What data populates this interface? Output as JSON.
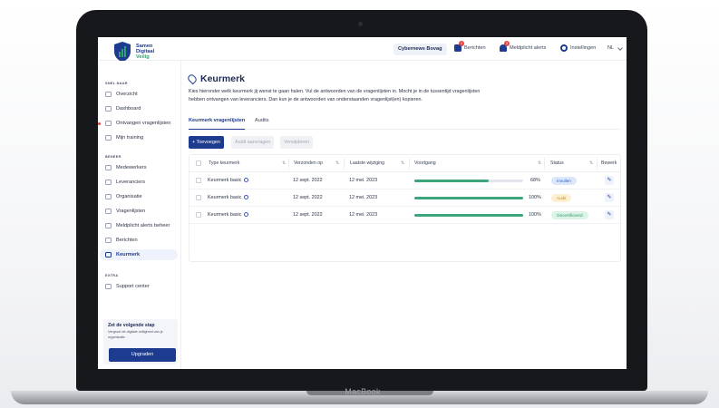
{
  "device": {
    "brand": "MacBook"
  },
  "app": {
    "logo": {
      "line1": "Samen",
      "line2": "Digitaal",
      "line3": "Veilig"
    },
    "org": "Cybernews Bovag",
    "topbar": {
      "berichten": "Berichten",
      "berichten_count": "1",
      "meldplicht": "Meldplicht alerts",
      "meldplicht_count": "3",
      "instellingen": "Instellingen",
      "lang": "NL"
    },
    "sidebar": {
      "section_snel": "SNEL NAAR",
      "snel": [
        {
          "label": "Overzicht"
        },
        {
          "label": "Dashboard"
        },
        {
          "label": "Ontvangen vragenlijsten"
        },
        {
          "label": "Mijn training"
        }
      ],
      "section_beheer": "BEHEER",
      "beheer": [
        {
          "label": "Medewerkers"
        },
        {
          "label": "Leveranciers"
        },
        {
          "label": "Organisatie"
        },
        {
          "label": "Vragenlijsten"
        },
        {
          "label": "Meldplicht alerts beheer"
        },
        {
          "label": "Berichten"
        },
        {
          "label": "Keurmerk"
        }
      ],
      "section_extra": "EXTRA",
      "extra": [
        {
          "label": "Support center"
        }
      ],
      "promo": {
        "title": "Zet de volgende stap",
        "text": "Vergroot de digitale veiligheid van je organisatie.",
        "button": "Upgraden"
      }
    },
    "main": {
      "title": "Keurmerk",
      "intro": "Kies hieronder welk keurmerk jij wenst te gaan halen. Vul de antwoorden van de vragenlijsten in. Mocht je in de tussentijd vragenlijsten hebben ontvangen van leveranciers. Dan kun je de antwoorden van onderstaanden vragenlijst(en) kopieren.",
      "tabs": [
        "Keurmerk vragenlijsten",
        "Audits"
      ],
      "actions": {
        "add": "+ Toevoegen",
        "audit": "Audit aanvragen",
        "delete": "Verwijderen"
      },
      "columns": [
        "Type keurmerk",
        "Verzonden op",
        "Laatste wijziging",
        "Voortgang",
        "Status",
        "Bewerk"
      ],
      "rows": [
        {
          "type": "Keurmerk basic",
          "sent": "12 sept. 2022",
          "changed": "12 mei. 2023",
          "progress": 68,
          "progress_label": "68%",
          "status": "Invullen",
          "status_color": "#dbe8fb",
          "status_text_color": "#2f5bd3"
        },
        {
          "type": "Keurmerk basic",
          "sent": "12 sept. 2022",
          "changed": "12 mei. 2023",
          "progress": 100,
          "progress_label": "100%",
          "status": "Audit",
          "status_color": "#fdf0d2",
          "status_text_color": "#c98a10"
        },
        {
          "type": "Keurmerk basic",
          "sent": "12 sept. 2022",
          "changed": "12 mei. 2023",
          "progress": 100,
          "progress_label": "100%",
          "status": "Gecertificeerd",
          "status_color": "#dcf3e8",
          "status_text_color": "#2f9a69"
        }
      ]
    },
    "colors": {
      "brand": "#1d3b8f",
      "progress": "#3ca57a",
      "alert": "#e04545"
    }
  }
}
